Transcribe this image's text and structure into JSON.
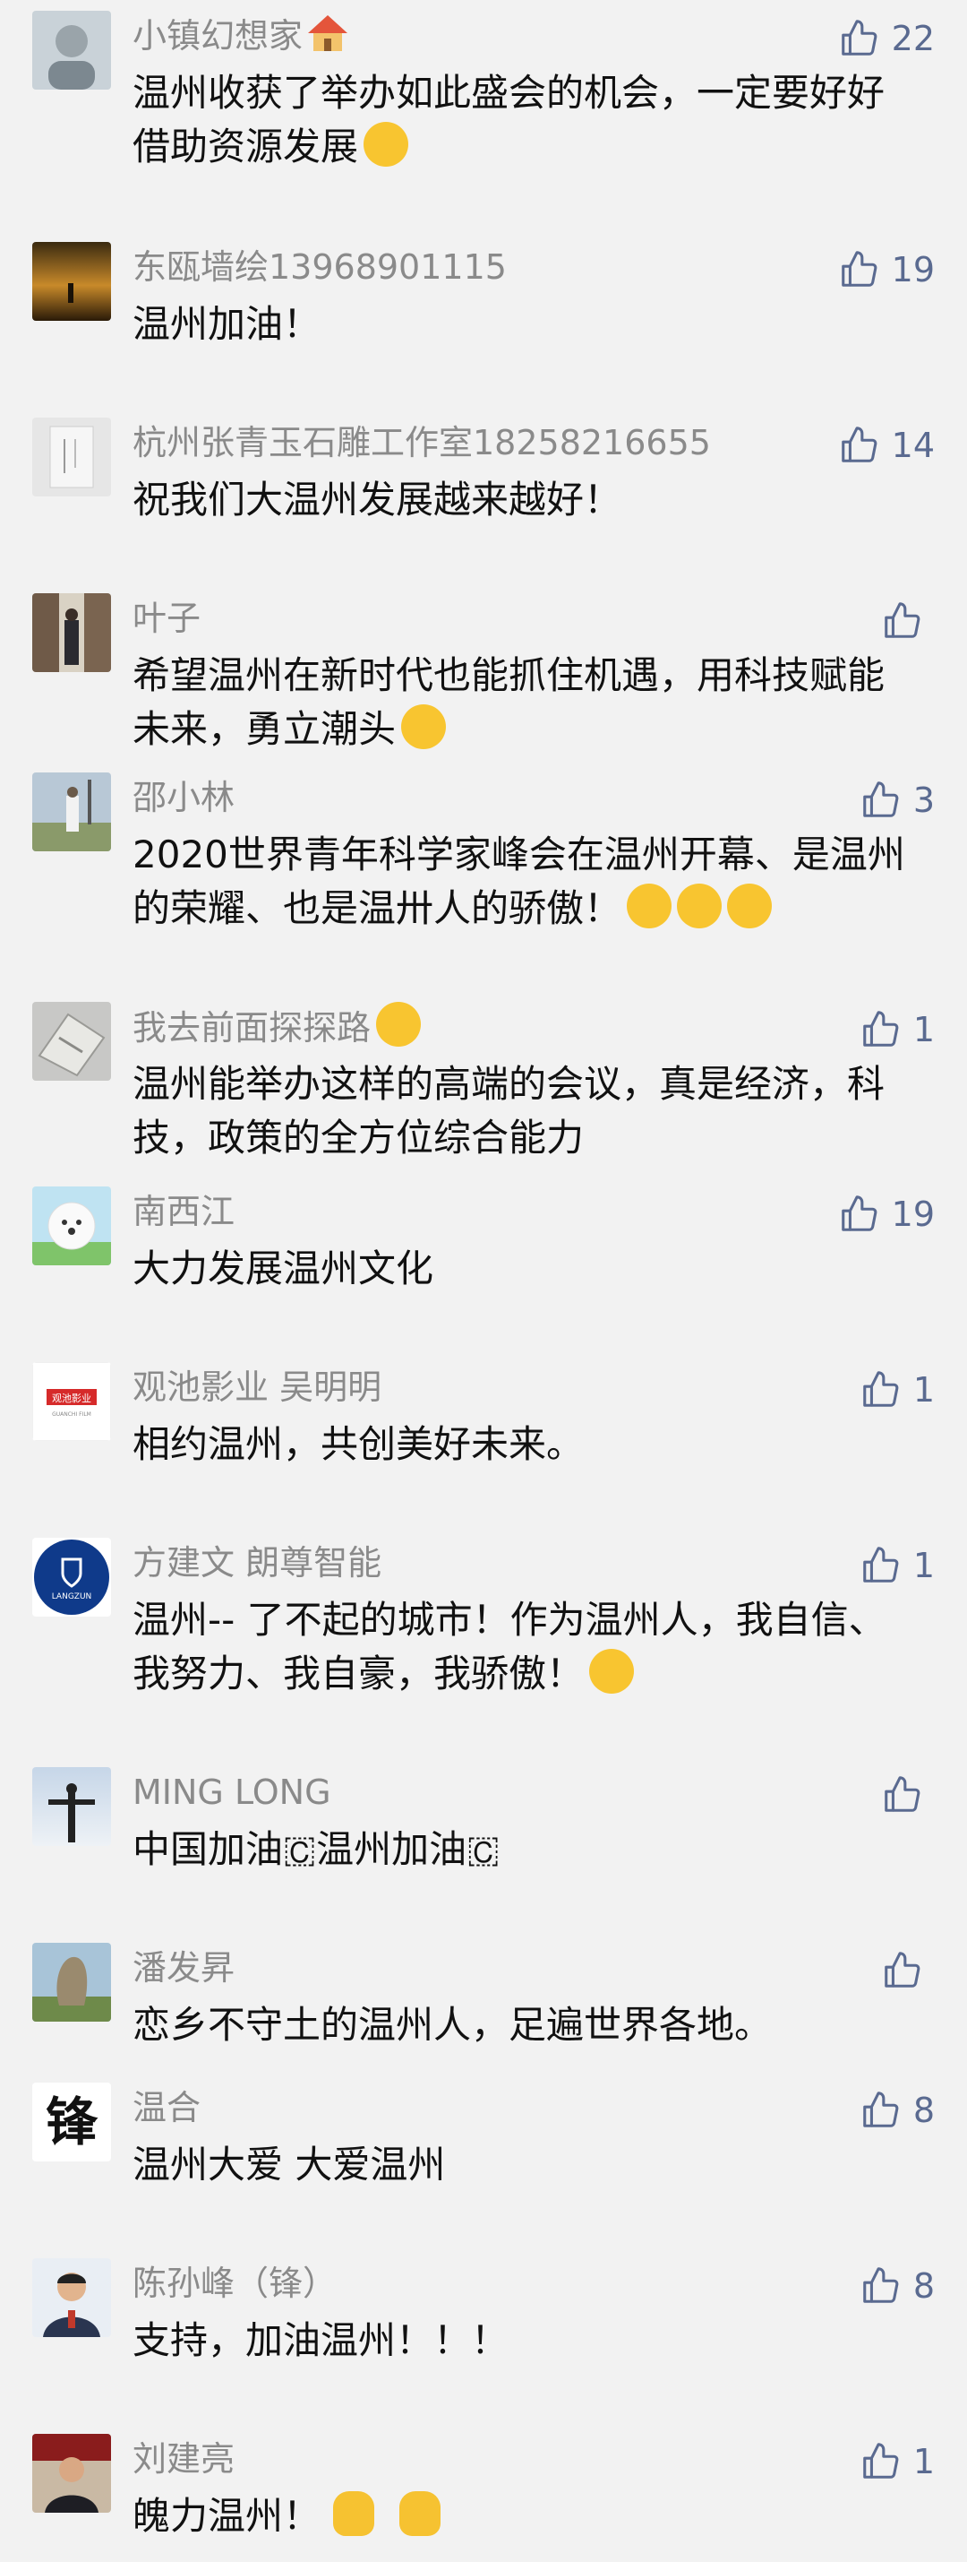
{
  "comments": [
    {
      "name": "小镇幻想家",
      "likes": "22",
      "text": "温州收获了举办如此盛会的机会，一定要好好借助资源发展",
      "name_emoji": "house-icon",
      "text_emoji": "shushing-face-emoji"
    },
    {
      "name": "东瓯墙绘13968901115",
      "likes": "19",
      "text": "温州加油！"
    },
    {
      "name": "杭州张青玉石雕工作室18258216655",
      "likes": "14",
      "text": "祝我们大温州发展越来越好！"
    },
    {
      "name": "叶子",
      "likes": "",
      "text": "希望温州在新时代也能抓住机遇，用科技赋能未来，勇立潮头",
      "text_emoji": "shushing-face-emoji"
    },
    {
      "name": "邵小林",
      "likes": "3",
      "text": "2020世界青年科学家峰会在温州开幕、是温州的荣耀、也是温卅人的骄傲！",
      "text_emoji": "hugging-face-emoji x3"
    },
    {
      "name": "我去前面探探路",
      "likes": "1",
      "text": "温州能举办这样的高端的会议，真是经济，科技，政策的全方位综合能力",
      "name_emoji": "grinning-face-emoji"
    },
    {
      "name": "南西江",
      "likes": "19",
      "text": "大力发展温州文化"
    },
    {
      "name": "观池影业 吴明明",
      "likes": "1",
      "text": "相约温州，共创美好未来。"
    },
    {
      "name": "方建文 朗尊智能",
      "likes": "1",
      "text": "温州-- 了不起的城市！作为温州人，我自信、我努力、我自豪，我骄傲！",
      "text_emoji": "smiling-face-emoji"
    },
    {
      "name": "MING LONG",
      "likes": "",
      "text": "中国加油🇨温州加油🇨"
    },
    {
      "name": "潘发昇",
      "likes": "",
      "text": "恋乡不守土的温州人，足遍世界各地。"
    },
    {
      "name": "温合",
      "likes": "8",
      "text": "温州大爱 大爱温州"
    },
    {
      "name": "陈孙峰（锋）",
      "likes": "8",
      "text": "支持，加油温州！！！"
    },
    {
      "name": "刘建亮",
      "likes": "1",
      "text": "魄力温州！",
      "text_emoji": "raised-fist-emoji x2"
    }
  ],
  "avatars": {
    "c2_logo_text": "观池影业",
    "c2_logo_sub": "GUANCHI FILM",
    "c3_logo_text": "LANGZUN",
    "c4_char": "锋"
  },
  "colors": {
    "background": "#f2f2f2",
    "name": "#8a8a8a",
    "text": "#111111",
    "like": "#5a6a90",
    "emoji": "#f8c530"
  }
}
